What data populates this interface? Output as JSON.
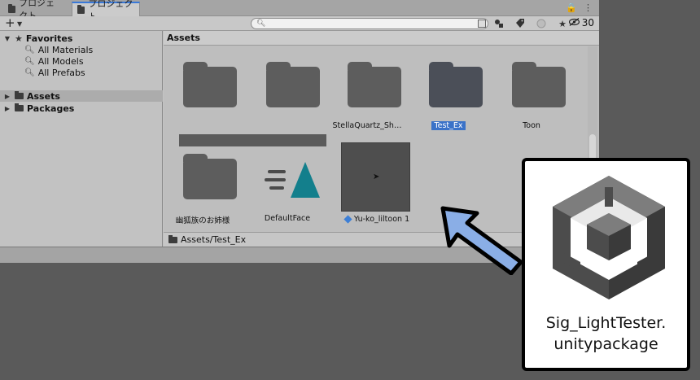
{
  "tabs": [
    {
      "label": "プロジェクト"
    },
    {
      "label": "プロジェクト"
    }
  ],
  "window_controls": {
    "lock": "🔒",
    "menu": "⋮"
  },
  "toolbar": {
    "add_symbol": "+",
    "search_value": "",
    "hidden_count": "30"
  },
  "tree": {
    "favorites_label": "Favorites",
    "favorites_items": [
      "All Materials",
      "All Models",
      "All Prefabs"
    ],
    "assets_label": "Assets",
    "packages_label": "Packages"
  },
  "assets_panel": {
    "header": "Assets",
    "items": [
      {
        "label": "",
        "type": "folder-redacted"
      },
      {
        "label": "",
        "type": "folder-redacted"
      },
      {
        "label": "StellaQuartz_Sh…",
        "type": "folder"
      },
      {
        "label": "Test_Ex",
        "type": "folder",
        "selected": true
      },
      {
        "label": "Toon",
        "type": "folder"
      },
      {
        "label": "幽狐族のお姉様",
        "type": "folder"
      },
      {
        "label": "DefaultFace",
        "type": "asset"
      },
      {
        "label": "Yu-ko_liltoon 1",
        "type": "prefab"
      }
    ],
    "path": "Assets/Test_Ex"
  },
  "package_card": {
    "file_name_line1": "Sig_LightTester.",
    "file_name_line2": "unitypackage"
  },
  "colors": {
    "window_bg": "#c2c2c2",
    "selection": "#3a72c8",
    "arrow_fill": "#8aaee6",
    "outer_bg": "#5a5a5a"
  }
}
